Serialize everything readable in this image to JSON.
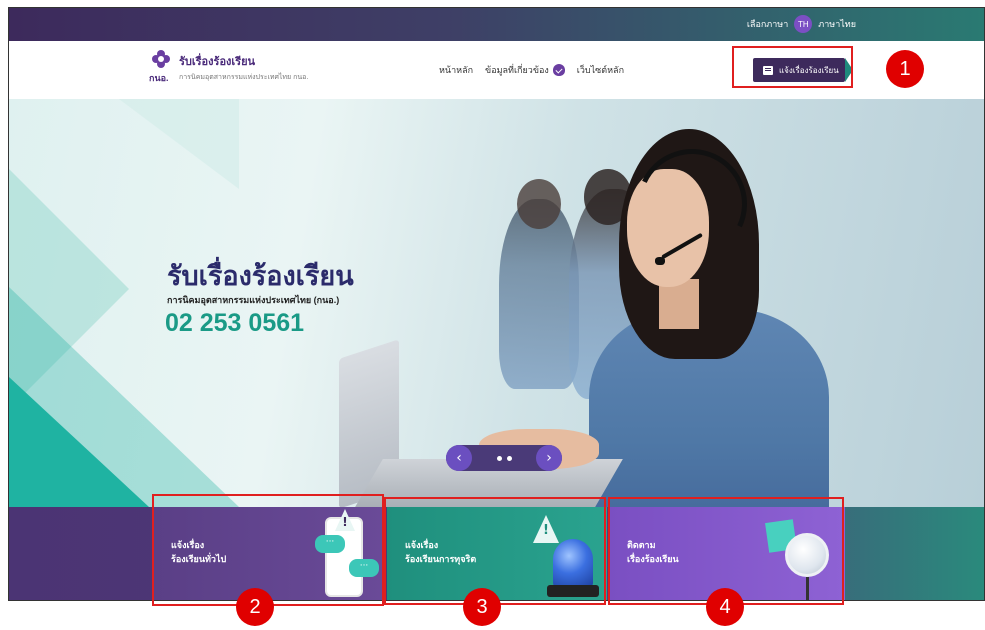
{
  "topbar": {
    "language_label": "เลือกภาษา",
    "language_code": "TH",
    "language_name": "ภาษาไทย"
  },
  "header": {
    "logo_title": "รับเรื่องร้องเรียน",
    "logo_subtitle": "การนิคมอุตสาหกรรมแห่งประเทศไทย กนอ.",
    "logo_abbr": "กนอ.",
    "nav": [
      {
        "label": "หน้าหลัก",
        "icon": null
      },
      {
        "label": "ข้อมูลที่เกี่ยวข้อง",
        "icon": "shield-check-icon"
      },
      {
        "label": "เว็บไซต์หลัก",
        "icon": null
      }
    ],
    "cta_label": "แจ้งเรื่องร้องเรียน",
    "cta_icon": "message-icon"
  },
  "hero": {
    "title": "รับเรื่องร้องเรียน",
    "subtitle": "การนิคมอุตสาหกรรมแห่งประเทศไทย (กนอ.)",
    "phone": "02 253 0561",
    "prev_symbol": "‹",
    "next_symbol": "›"
  },
  "cards": [
    {
      "line1": "แจ้งเรื่อง",
      "line2": "ร้องเรียนทั่วไป",
      "icon": "phone-chat-icon"
    },
    {
      "line1": "แจ้งเรื่อง",
      "line2": "ร้องเรียนการทุจริต",
      "icon": "siren-icon"
    },
    {
      "line1": "ติดตาม",
      "line2": "เรื่องร้องเรียน",
      "icon": "magnifier-icon"
    }
  ],
  "annotations": [
    "1",
    "2",
    "3",
    "4"
  ],
  "colors": {
    "brand_purple": "#3d2a5c",
    "teal": "#1f8f7d",
    "highlight_red": "#e01f1f"
  }
}
